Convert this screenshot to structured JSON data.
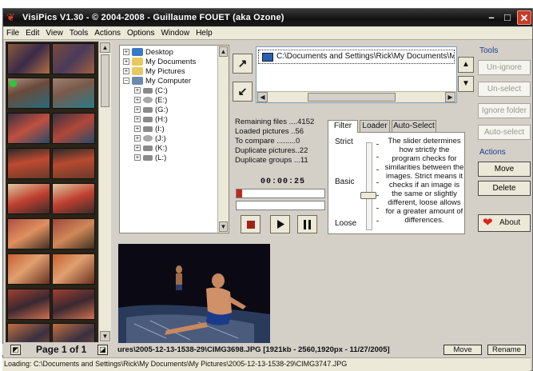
{
  "window": {
    "title": "VisiPics V1.30 - © 2004-2008 - Guillaume FOUET (aka Ozone)",
    "minimize": "–",
    "maximize": "□",
    "close": "✕"
  },
  "menu": [
    "File",
    "Edit",
    "View",
    "Tools",
    "Actions",
    "Options",
    "Window",
    "Help"
  ],
  "tree": {
    "items": [
      {
        "label": "Desktop",
        "icon": "desktop-icon"
      },
      {
        "label": "My Documents",
        "icon": "folder-icon"
      },
      {
        "label": "My Pictures",
        "icon": "folder-icon"
      },
      {
        "label": "My Computer",
        "icon": "computer-icon"
      },
      {
        "label": "(C:)",
        "icon": "drive-icon"
      },
      {
        "label": "(E:)",
        "icon": "cd-drive-icon"
      },
      {
        "label": "(G:)",
        "icon": "drive-icon"
      },
      {
        "label": "(H:)",
        "icon": "drive-icon"
      },
      {
        "label": "(I:)",
        "icon": "drive-icon"
      },
      {
        "label": "(J:)",
        "icon": "cd-drive-icon"
      },
      {
        "label": "(K:)",
        "icon": "drive-icon"
      },
      {
        "label": "(L:)",
        "icon": "drive-icon"
      }
    ]
  },
  "path": {
    "value": "C:\\Documents and Settings\\Rick\\My Documents\\M"
  },
  "stats": {
    "remaining": "Remaining files ....4152",
    "loaded": "Loaded pictures ..56",
    "compare": "To compare .........0",
    "duplicates": "Duplicate pictures..22",
    "groups": "Duplicate groups ...11",
    "timer": "00:00:25",
    "progress1": 0.06,
    "progress2": 0.0
  },
  "tabs": {
    "filter": "Filter",
    "loader": "Loader",
    "autoselect": "Auto-Select",
    "strict": "Strict",
    "basic": "Basic",
    "loose": "Loose",
    "level": 0.62,
    "description": "The slider determines how strictly the program checks for similarities between the images. Strict means it checks if an image is the same or slightly different, loose allows for a greater amount of differences."
  },
  "tools": {
    "label": "Tools",
    "unignore": "Un-ignore",
    "unselect": "Un-select",
    "ignore_folder": "Ignore folder",
    "autoselect": "Auto-select"
  },
  "actions": {
    "label": "Actions",
    "move": "Move",
    "delete": "Delete",
    "about": "About"
  },
  "pager": {
    "label": "Page 1 of 1"
  },
  "preview": {
    "fileinfo": "ures\\2005-12-13-1538-29\\CIMG3698.JPG  [1921kb - 2560,1920px - 11/27/2005]",
    "move": "Move",
    "rename": "Rename"
  },
  "status": "Loading: C:\\Documents and Settings\\Rick\\My Documents\\My Pictures\\2005-12-13-1538-29\\CIMG3747.JPG",
  "colors": {
    "accent": "#c0281c",
    "title_bg": "#101010",
    "group_label": "#1f3c8a"
  }
}
